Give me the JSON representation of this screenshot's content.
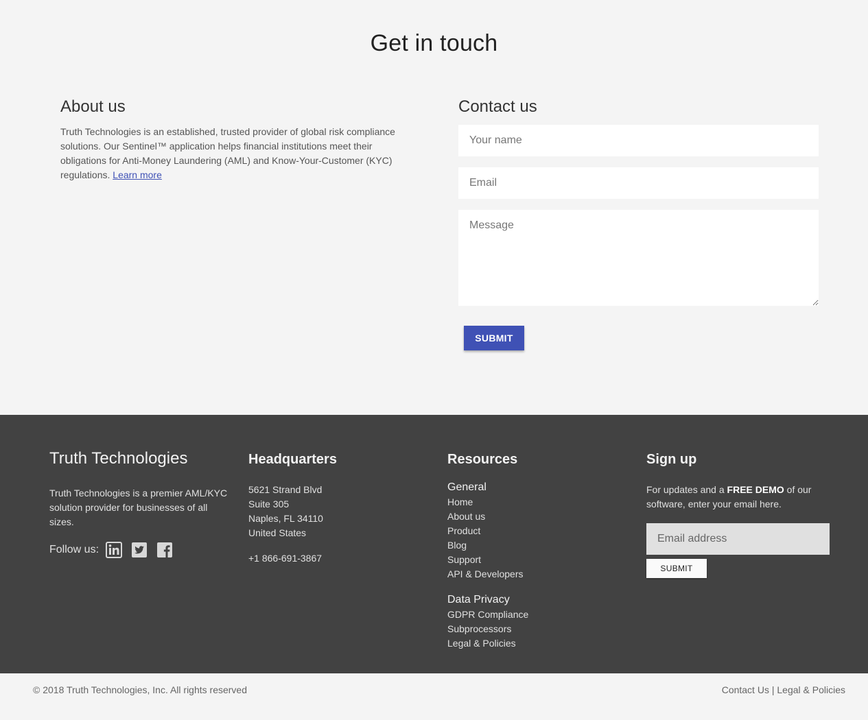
{
  "contact_section": {
    "title": "Get in touch",
    "about": {
      "heading": "About us",
      "body": "Truth Technologies is an established, trusted provider of global risk compliance solutions. Our Sentinel™ application helps financial institutions meet their obligations for Anti-Money Laundering (AML) and Know-Your-Customer (KYC) regulations. ",
      "link_label": "Learn more"
    },
    "form": {
      "heading": "Contact us",
      "name_placeholder": "Your name",
      "email_placeholder": "Email",
      "message_placeholder": "Message",
      "submit_label": "SUBMIT"
    }
  },
  "footer": {
    "brand": {
      "title": "Truth Technologies",
      "description": "Truth Technologies is a premier AML/KYC solution provider for businesses of all sizes.",
      "follow_label": "Follow us:",
      "social_icons": [
        "linkedin-icon",
        "twitter-icon",
        "facebook-icon"
      ]
    },
    "headquarters": {
      "heading": "Headquarters",
      "address": [
        "5621 Strand Blvd",
        "Suite 305",
        "Naples, FL 34110",
        "United States"
      ],
      "phone": "+1 866-691-3867"
    },
    "resources": {
      "heading": "Resources",
      "groups": [
        {
          "title": "General",
          "links": [
            "Home",
            "About us",
            "Product",
            "Blog",
            "Support",
            "API & Developers"
          ]
        },
        {
          "title": "Data Privacy",
          "links": [
            "GDPR Compliance",
            "Subprocessors",
            "Legal & Policies"
          ]
        }
      ]
    },
    "signup": {
      "heading": "Sign up",
      "text_before": "For updates and a ",
      "text_bold": "FREE DEMO",
      "text_after": " of our software, enter your email here.",
      "email_placeholder": "Email address",
      "submit_label": "SUBMIT"
    }
  },
  "bottom_bar": {
    "copyright": "© 2018 Truth Technologies, Inc. All rights reserved",
    "links": [
      "Contact Us",
      "Legal & Policies"
    ],
    "separator": " | "
  },
  "colors": {
    "accent": "#3f51b5",
    "footer_bg": "#424242",
    "page_bg": "#f4f4f4"
  }
}
